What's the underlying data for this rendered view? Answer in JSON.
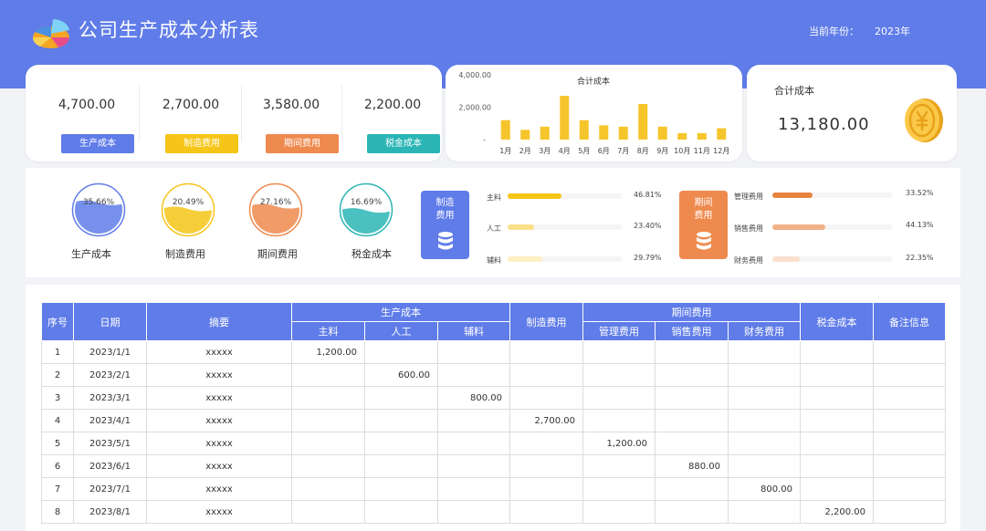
{
  "header": {
    "title": "公司生产成本分析表",
    "year_label": "当前年份：",
    "year_value": "2023年"
  },
  "kpis": [
    {
      "value": "4,700.00",
      "label": "生产成本",
      "color": "#5f7ce8"
    },
    {
      "value": "2,700.00",
      "label": "制造费用",
      "color": "#f5c518"
    },
    {
      "value": "3,580.00",
      "label": "期间费用",
      "color": "#ee8a4e"
    },
    {
      "value": "2,200.00",
      "label": "税金成本",
      "color": "#2bb5b5"
    }
  ],
  "chart_data": {
    "type": "bar",
    "title": "合计成本",
    "categories": [
      "1月",
      "2月",
      "3月",
      "4月",
      "5月",
      "6月",
      "7月",
      "8月",
      "9月",
      "10月",
      "11月",
      "12月"
    ],
    "values": [
      1200,
      600,
      800,
      2700,
      1200,
      880,
      800,
      2200,
      800,
      400,
      400,
      700
    ],
    "yticks": [
      "4,000.00",
      "2,000.00",
      "-"
    ],
    "ylim": [
      0,
      4000
    ],
    "color": "#f6c52b"
  },
  "total": {
    "label": "合计成本",
    "value": "13,180.00"
  },
  "rings": [
    {
      "pct": "35.66%",
      "fraction": 0.3566,
      "label": "生产成本",
      "color": "#5f7ce8"
    },
    {
      "pct": "20.49%",
      "fraction": 0.2049,
      "label": "制造费用",
      "color": "#f5c518"
    },
    {
      "pct": "27.16%",
      "fraction": 0.2716,
      "label": "期间费用",
      "color": "#ee8a4e"
    },
    {
      "pct": "16.69%",
      "fraction": 0.1669,
      "label": "税金成本",
      "color": "#2bb5b5"
    }
  ],
  "manufacturing": {
    "title": "制造\n费用",
    "color": "#5f7ce8",
    "items": [
      {
        "label": "主料",
        "pct": "46.81%",
        "fraction": 0.4681,
        "color": "#f5c518"
      },
      {
        "label": "人工",
        "pct": "23.40%",
        "fraction": 0.234,
        "color": "#fbe08a"
      },
      {
        "label": "辅料",
        "pct": "29.79%",
        "fraction": 0.2979,
        "color": "#fdf0c4"
      }
    ]
  },
  "period": {
    "title": "期间\n费用",
    "color": "#ee8a4e",
    "items": [
      {
        "label": "管理费用",
        "pct": "33.52%",
        "fraction": 0.3352,
        "color": "#e6843f"
      },
      {
        "label": "销售费用",
        "pct": "44.13%",
        "fraction": 0.4413,
        "color": "#f0b088"
      },
      {
        "label": "财务费用",
        "pct": "22.35%",
        "fraction": 0.2235,
        "color": "#fbe0cf"
      }
    ]
  },
  "table": {
    "headers": {
      "seq": "序号",
      "date": "日期",
      "summary": "摘要",
      "production": "生产成本",
      "main": "主料",
      "labor": "人工",
      "aux": "辅料",
      "manufacturing": "制造费用",
      "period": "期间费用",
      "mgmt": "管理费用",
      "sales": "销售费用",
      "finance": "财务费用",
      "tax": "税金成本",
      "notes": "备注信息"
    },
    "rows": [
      [
        "1",
        "2023/1/1",
        "xxxxx",
        "1,200.00",
        "",
        "",
        "",
        "",
        "",
        "",
        "",
        ""
      ],
      [
        "2",
        "2023/2/1",
        "xxxxx",
        "",
        "600.00",
        "",
        "",
        "",
        "",
        "",
        "",
        ""
      ],
      [
        "3",
        "2023/3/1",
        "xxxxx",
        "",
        "",
        "800.00",
        "",
        "",
        "",
        "",
        "",
        ""
      ],
      [
        "4",
        "2023/4/1",
        "xxxxx",
        "",
        "",
        "",
        "2,700.00",
        "",
        "",
        "",
        "",
        ""
      ],
      [
        "5",
        "2023/5/1",
        "xxxxx",
        "",
        "",
        "",
        "",
        "1,200.00",
        "",
        "",
        "",
        ""
      ],
      [
        "6",
        "2023/6/1",
        "xxxxx",
        "",
        "",
        "",
        "",
        "",
        "880.00",
        "",
        "",
        ""
      ],
      [
        "7",
        "2023/7/1",
        "xxxxx",
        "",
        "",
        "",
        "",
        "",
        "",
        "800.00",
        "",
        ""
      ],
      [
        "8",
        "2023/8/1",
        "xxxxx",
        "",
        "",
        "",
        "",
        "",
        "",
        "",
        "2,200.00",
        ""
      ]
    ]
  }
}
